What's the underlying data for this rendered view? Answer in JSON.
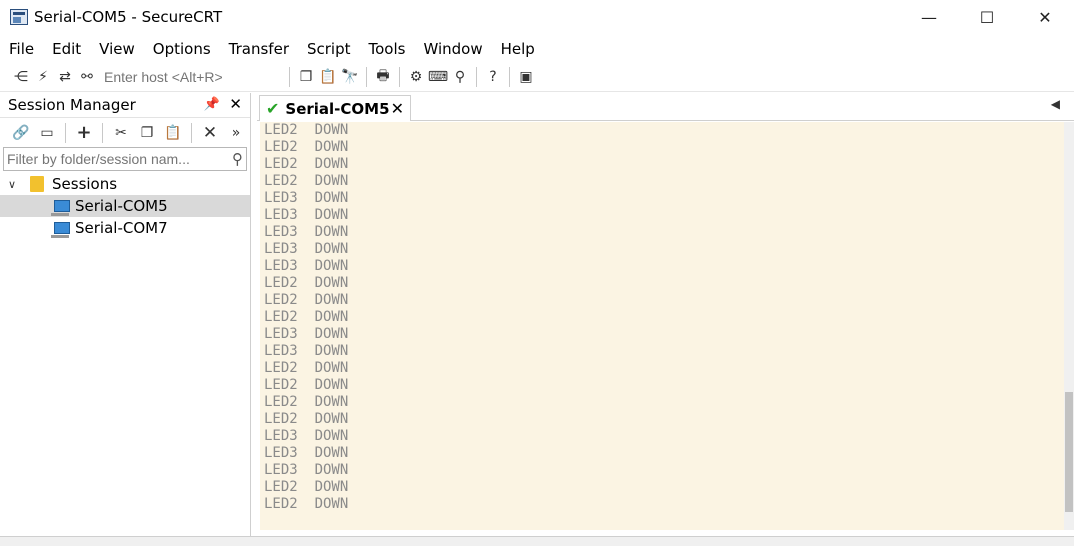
{
  "window": {
    "title": "Serial-COM5 - SecureCRT",
    "minimize": "—",
    "maximize": "☐",
    "close": "✕"
  },
  "menu": {
    "items": [
      {
        "label": "File"
      },
      {
        "label": "Edit"
      },
      {
        "label": "View"
      },
      {
        "label": "Options"
      },
      {
        "label": "Transfer"
      },
      {
        "label": "Script"
      },
      {
        "label": "Tools"
      },
      {
        "label": "Window"
      },
      {
        "label": "Help"
      }
    ]
  },
  "toolbar": {
    "host_placeholder": "Enter host <Alt+R>",
    "icons": [
      "connect-icon",
      "quick-connect-icon",
      "reconnect-icon",
      "disconnect-icon",
      "copy-icon",
      "paste-icon",
      "find-icon",
      "print-icon",
      "settings-icon",
      "keymap-icon",
      "sftp-icon",
      "help-icon",
      "session-options-icon"
    ]
  },
  "session_manager": {
    "title": "Session Manager",
    "pin": "📌",
    "close": "✕",
    "filter_placeholder": "Filter by folder/session nam...",
    "tree": {
      "folder": "Sessions",
      "sessions": [
        "Serial-COM5",
        "Serial-COM7"
      ]
    }
  },
  "tabs": [
    {
      "label": "Serial-COM5",
      "status": "connected"
    }
  ],
  "terminal": {
    "lines": [
      "LED2  DOWN",
      "LED2  DOWN",
      "LED2  DOWN",
      "LED2  DOWN",
      "LED3  DOWN",
      "LED3  DOWN",
      "LED3  DOWN",
      "LED3  DOWN",
      "LED3  DOWN",
      "LED2  DOWN",
      "LED2  DOWN",
      "LED2  DOWN",
      "LED3  DOWN",
      "LED3  DOWN",
      "LED2  DOWN",
      "LED2  DOWN",
      "LED2  DOWN",
      "LED2  DOWN",
      "LED3  DOWN",
      "LED3  DOWN",
      "LED3  DOWN",
      "LED2  DOWN",
      "LED2  DOWN"
    ]
  },
  "colors": {
    "terminal_bg": "#fbf4e3",
    "terminal_fg": "#8a8a8a",
    "connected_check": "#28a428",
    "selected_row": "#d9d9d9"
  }
}
